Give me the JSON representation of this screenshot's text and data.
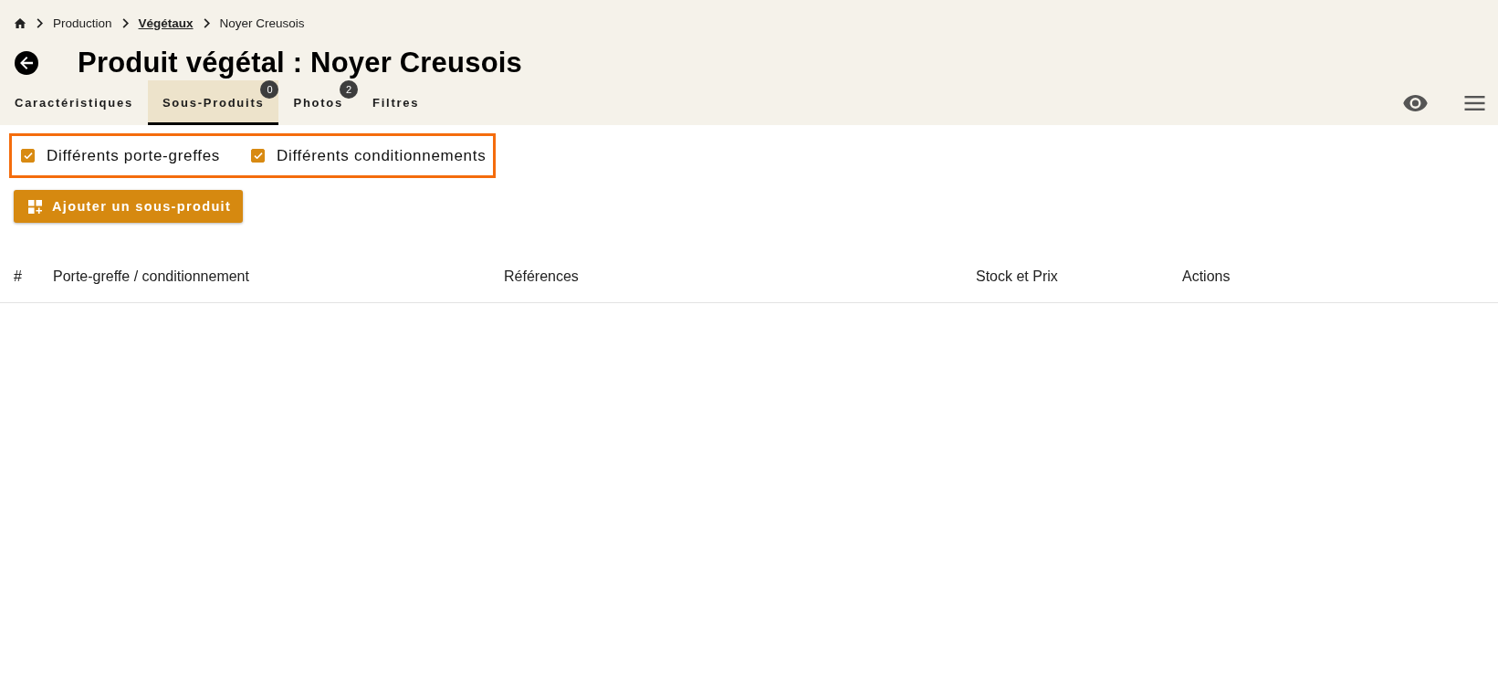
{
  "breadcrumb": [
    {
      "label": "Production",
      "kind": "plain"
    },
    {
      "label": "Végétaux",
      "kind": "link"
    },
    {
      "label": "Noyer Creusois",
      "kind": "plain"
    }
  ],
  "page": {
    "title": "Produit végétal : Noyer Creusois"
  },
  "tabs": [
    {
      "label": "Caractéristiques",
      "selected": false
    },
    {
      "label": "Sous-Produits",
      "selected": true,
      "badge": "0"
    },
    {
      "label": "Photos",
      "selected": false,
      "badge": "2"
    },
    {
      "label": "Filtres",
      "selected": false
    }
  ],
  "options": {
    "highlighted": true,
    "items": [
      {
        "label": "Différents porte-greffes",
        "checked": true
      },
      {
        "label": "Différents conditionnements",
        "checked": true
      }
    ]
  },
  "add_button": {
    "label": "Ajouter un sous-produit"
  },
  "table": {
    "columns": [
      "#",
      "Porte-greffe / conditionnement",
      "Références",
      "Stock et Prix",
      "Actions"
    ]
  }
}
